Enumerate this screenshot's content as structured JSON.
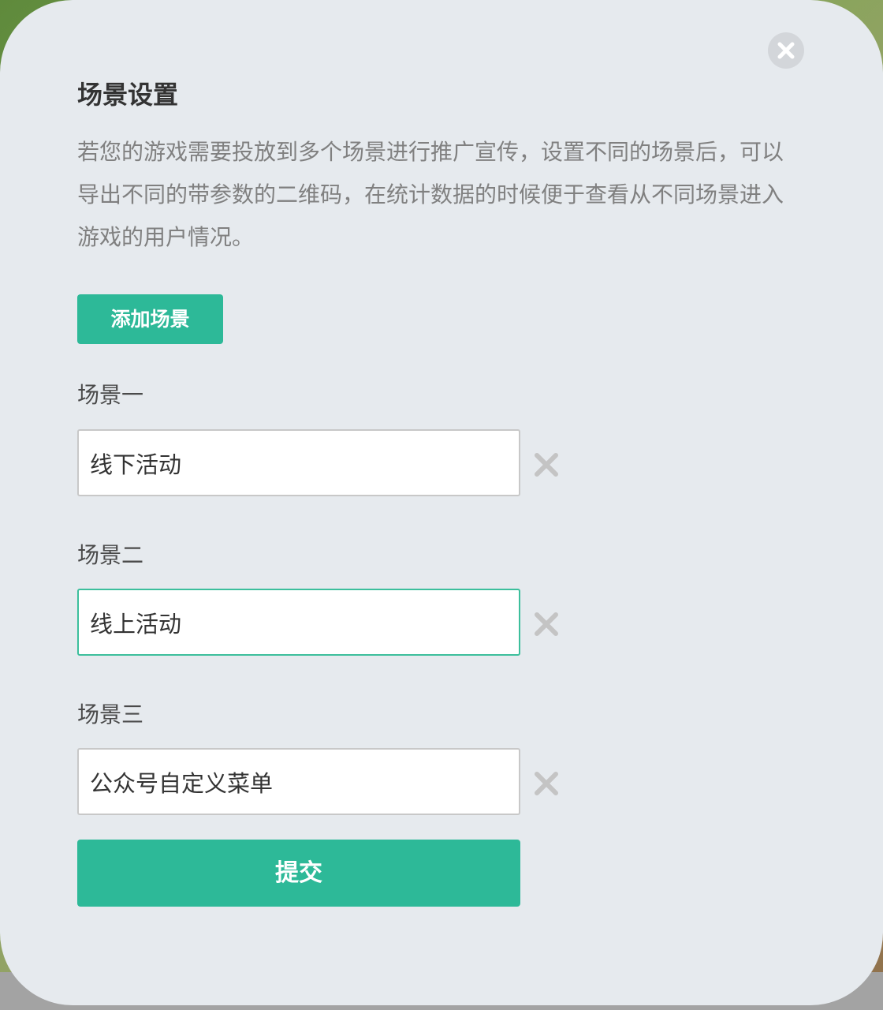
{
  "dialog": {
    "title": "场景设置",
    "description": "若您的游戏需要投放到多个场景进行推广宣传，设置不同的场景后，可以导出不同的带参数的二维码，在统计数据的时候便于查看从不同场景进入游戏的用户情况。",
    "close_icon": "close-circle-icon",
    "add_button_label": "添加场景",
    "scenes": [
      {
        "label": "场景一",
        "value": "线下活动",
        "focused": false
      },
      {
        "label": "场景二",
        "value": "线上活动",
        "focused": true
      },
      {
        "label": "场景三",
        "value": "公众号自定义菜单",
        "focused": false
      }
    ],
    "delete_icon": "x-icon",
    "submit_label": "提交"
  },
  "colors": {
    "accent": "#2db998",
    "dialog_background": "#e6eaee",
    "focus_border": "#3cbf9c"
  }
}
